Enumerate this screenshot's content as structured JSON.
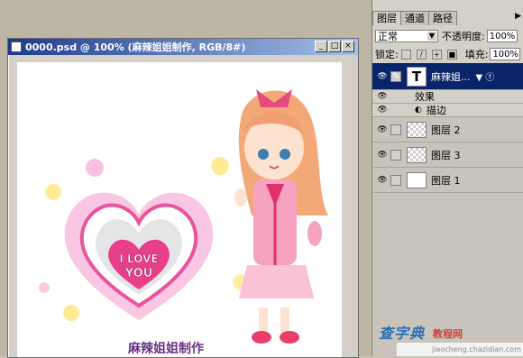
{
  "document": {
    "title": "0000.psd @ 100% (麻辣姐姐制作, RGB/8#)",
    "canvas_text": "麻辣姐姐制作",
    "heart_text_line1": "I LOVE",
    "heart_text_line2": "YOU"
  },
  "layers_panel": {
    "tabs": [
      "图层",
      "通道",
      "路径"
    ],
    "blend_mode": "正常",
    "opacity_label": "不透明度:",
    "opacity_value": "100%",
    "lock_label": "锁定:",
    "fill_label": "填充:",
    "fill_value": "100%",
    "layers": [
      {
        "name": "麻辣姐...",
        "thumb": "T",
        "selected": true
      },
      {
        "name": "效果"
      },
      {
        "name": "描边"
      },
      {
        "name": "图层 2"
      },
      {
        "name": "图层 3"
      },
      {
        "name": "图层 1"
      }
    ]
  },
  "watermark": {
    "site": "jiaocheng.chazidian.com",
    "logo": "查字典",
    "logo2": "教程网"
  },
  "colors": {
    "selection": "#0a246a",
    "title_start": "#1c3c8c",
    "heart_pink": "#e8559d"
  }
}
